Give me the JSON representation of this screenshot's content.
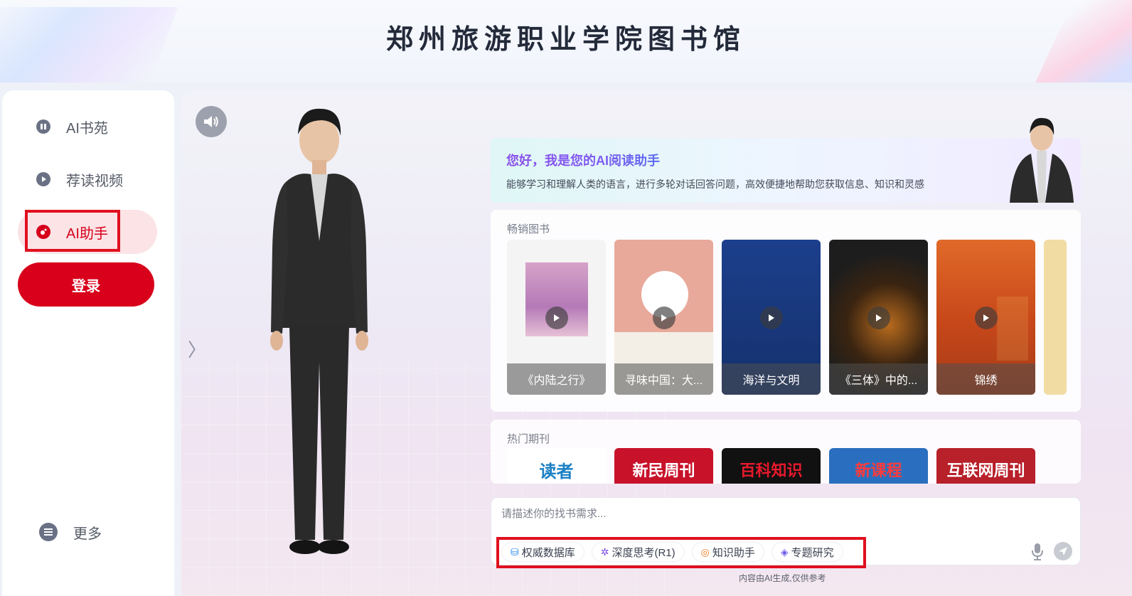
{
  "header": {
    "title": "郑州旅游职业学院图书馆"
  },
  "sidebar": {
    "items": [
      {
        "label": "AI书苑",
        "icon": "book-icon"
      },
      {
        "label": "荐读视频",
        "icon": "play-icon"
      },
      {
        "label": "AI助手",
        "icon": "assistant-icon"
      }
    ],
    "login_label": "登录",
    "more_label": "更多"
  },
  "welcome": {
    "title": "您好，我是您的AI阅读助手",
    "subtitle": "能够学习和理解人类的语言，进行多轮对话回答问题，高效便捷地帮助您获取信息、知识和灵感"
  },
  "bestsellers": {
    "title": "畅销图书",
    "books": [
      {
        "caption": "《内陆之行》",
        "cover_color": "#f4f4f4"
      },
      {
        "caption": "寻味中国：大...",
        "cover_color": "#e8a99a"
      },
      {
        "caption": "海洋与文明",
        "cover_color": "#1c3f8c"
      },
      {
        "caption": "《三体》中的...",
        "cover_color": "#1d1d1d"
      },
      {
        "caption": "锦绣",
        "cover_color": "#d9521f"
      }
    ]
  },
  "journals": {
    "title": "热门期刊",
    "items": [
      {
        "name": "读者",
        "bg": "#ffffff",
        "fg": "#1b7fc4"
      },
      {
        "name": "新民周刊",
        "bg": "#c8122a",
        "fg": "#ffffff"
      },
      {
        "name": "百科知识",
        "bg": "#111111",
        "fg": "#e8192c"
      },
      {
        "name": "新课程",
        "bg": "#2a6fbf",
        "fg": "#ff3a3a"
      },
      {
        "name": "互联网周刊",
        "bg": "#b8202a",
        "fg": "#ffffff"
      }
    ]
  },
  "chat": {
    "placeholder": "请描述你的找书需求...",
    "chips": [
      {
        "label": "权威数据库",
        "icon": "database-icon",
        "color": "#2f8ce6"
      },
      {
        "label": "深度思考(R1)",
        "icon": "deep-think-icon",
        "color": "#7b4fe0"
      },
      {
        "label": "知识助手",
        "icon": "knowledge-icon",
        "color": "#f07a1f"
      },
      {
        "label": "专题研究",
        "icon": "research-icon",
        "color": "#6a5be6"
      }
    ],
    "disclaimer": "内容由AI生成,仅供参考"
  },
  "colors": {
    "brand": "#d9001b",
    "active_bg": "#fbe3e6",
    "highlight": "#e0101f"
  }
}
